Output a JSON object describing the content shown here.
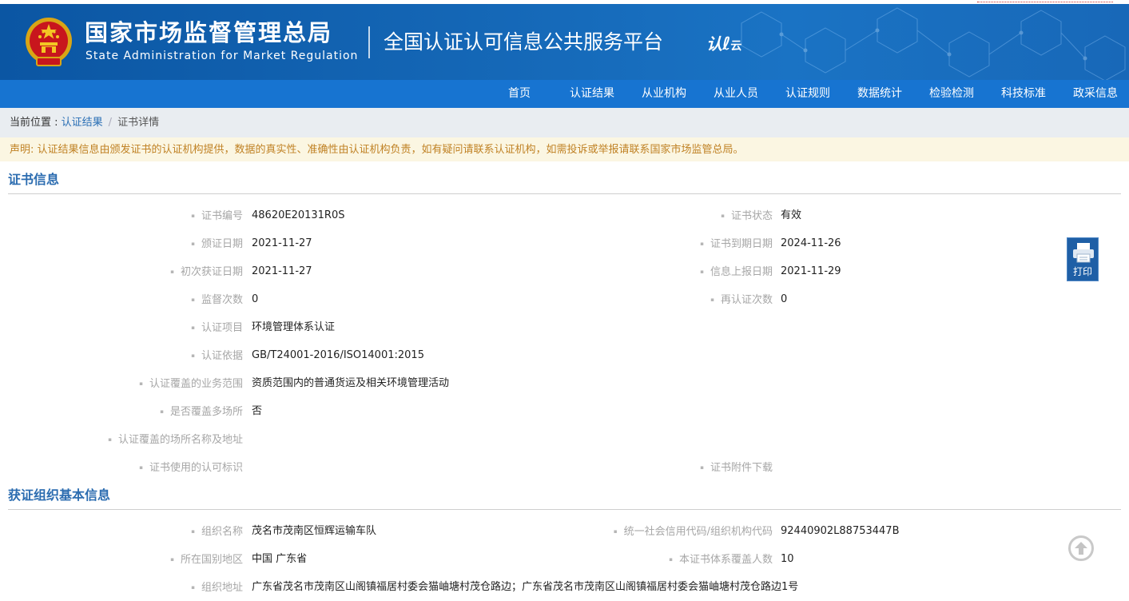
{
  "header": {
    "agency_cn": "国家市场监督管理总局",
    "agency_en": "State Administration  for  Market Regulation",
    "platform": "全国认证认可信息公共服务平台",
    "cloud_logo": "认",
    "cloud_logo_small": "云",
    "icons": [
      "national-emblem-icon",
      "cloud-logo-icon"
    ],
    "colors": {
      "header_bg": "#0b56a3",
      "nav_bg": "#1774d1",
      "section_title": "#2b6cb0",
      "notice_text": "#c08225"
    }
  },
  "nav": {
    "items": [
      {
        "label": "首页"
      },
      {
        "label": "认证结果"
      },
      {
        "label": "从业机构"
      },
      {
        "label": "从业人员"
      },
      {
        "label": "认证规则"
      },
      {
        "label": "数据统计"
      },
      {
        "label": "检验检测"
      },
      {
        "label": "科技标准"
      },
      {
        "label": "政采信息"
      }
    ]
  },
  "breadcrumb": {
    "prefix": "当前位置 : ",
    "link": "认证结果",
    "separator": "/",
    "current": "证书详情"
  },
  "notice": "声明: 认证结果信息由颁发证书的认证机构提供，数据的真实性、准确性由认证机构负责，如有疑问请联系认证机构，如需投诉或举报请联系国家市场监管总局。",
  "certificate": {
    "title": "证书信息",
    "fields": {
      "cert_no": {
        "label": "证书编号",
        "value": "48620E20131R0S"
      },
      "status": {
        "label": "证书状态",
        "value": "有效"
      },
      "issue_date": {
        "label": "颁证日期",
        "value": "2021-11-27"
      },
      "expiry_date": {
        "label": "证书到期日期",
        "value": "2024-11-26"
      },
      "first_date": {
        "label": "初次获证日期",
        "value": "2021-11-27"
      },
      "report_date": {
        "label": "信息上报日期",
        "value": "2021-11-29"
      },
      "supervision_count": {
        "label": "监督次数",
        "value": "0"
      },
      "recert_count": {
        "label": "再认证次数",
        "value": "0"
      },
      "project": {
        "label": "认证项目",
        "value": "环境管理体系认证"
      },
      "basis": {
        "label": "认证依据",
        "value": "GB/T24001-2016/ISO14001:2015"
      },
      "scope": {
        "label": "认证覆盖的业务范围",
        "value": "资质范围内的普通货运及相关环境管理活动"
      },
      "multi_site": {
        "label": "是否覆盖多场所",
        "value": "否"
      },
      "sites": {
        "label": "认证覆盖的场所名称及地址",
        "value": ""
      },
      "accreditation_mark": {
        "label": "证书使用的认可标识",
        "value": ""
      },
      "attachment": {
        "label": "证书附件下载",
        "value": ""
      }
    }
  },
  "organization": {
    "title": "获证组织基本信息",
    "fields": {
      "name": {
        "label": "组织名称",
        "value": "茂名市茂南区恒辉运输车队"
      },
      "credit_code": {
        "label": "统一社会信用代码/组织机构代码",
        "value": "92440902L88753447B"
      },
      "region": {
        "label": "所在国别地区",
        "value": "中国 广东省"
      },
      "covered_people": {
        "label": "本证书体系覆盖人数",
        "value": "10"
      },
      "address": {
        "label": "组织地址",
        "value": "广东省茂名市茂南区山阁镇福居村委会猫岫塘村茂仓路边；广东省茂名市茂南区山阁镇福居村委会猫岫塘村茂仓路边1号"
      }
    }
  },
  "print_button": {
    "label": "打印",
    "icon": "printer-icon"
  },
  "back_to_top": {
    "icon": "arrow-up-circle-icon"
  }
}
